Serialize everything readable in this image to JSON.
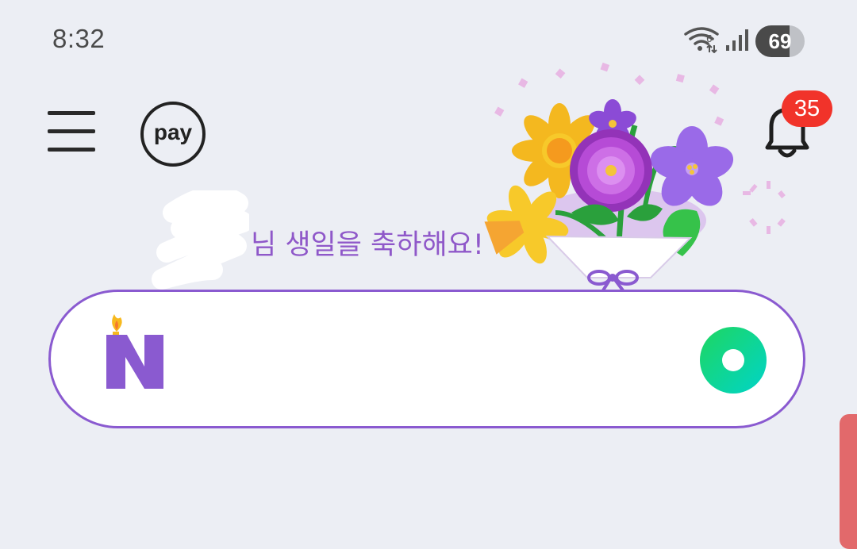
{
  "status_bar": {
    "time": "8:32",
    "battery_level": "69",
    "icons": [
      "wifi-icon",
      "signal-icon",
      "battery-icon"
    ]
  },
  "header": {
    "menu_icon": "hamburger-menu-icon",
    "pay_label": "pay",
    "notifications_icon": "bell-icon",
    "notification_count": "35"
  },
  "greeting": {
    "text": "님 생일을 축하해요!"
  },
  "search": {
    "logo_icon": "naver-birthday-n-icon",
    "value": "",
    "action_icon": "green-circle-icon"
  },
  "colors": {
    "accent": "#8a5ad0",
    "greeting_text": "#8f58c9",
    "badge": "#f1332a",
    "background": "#eceef4"
  }
}
